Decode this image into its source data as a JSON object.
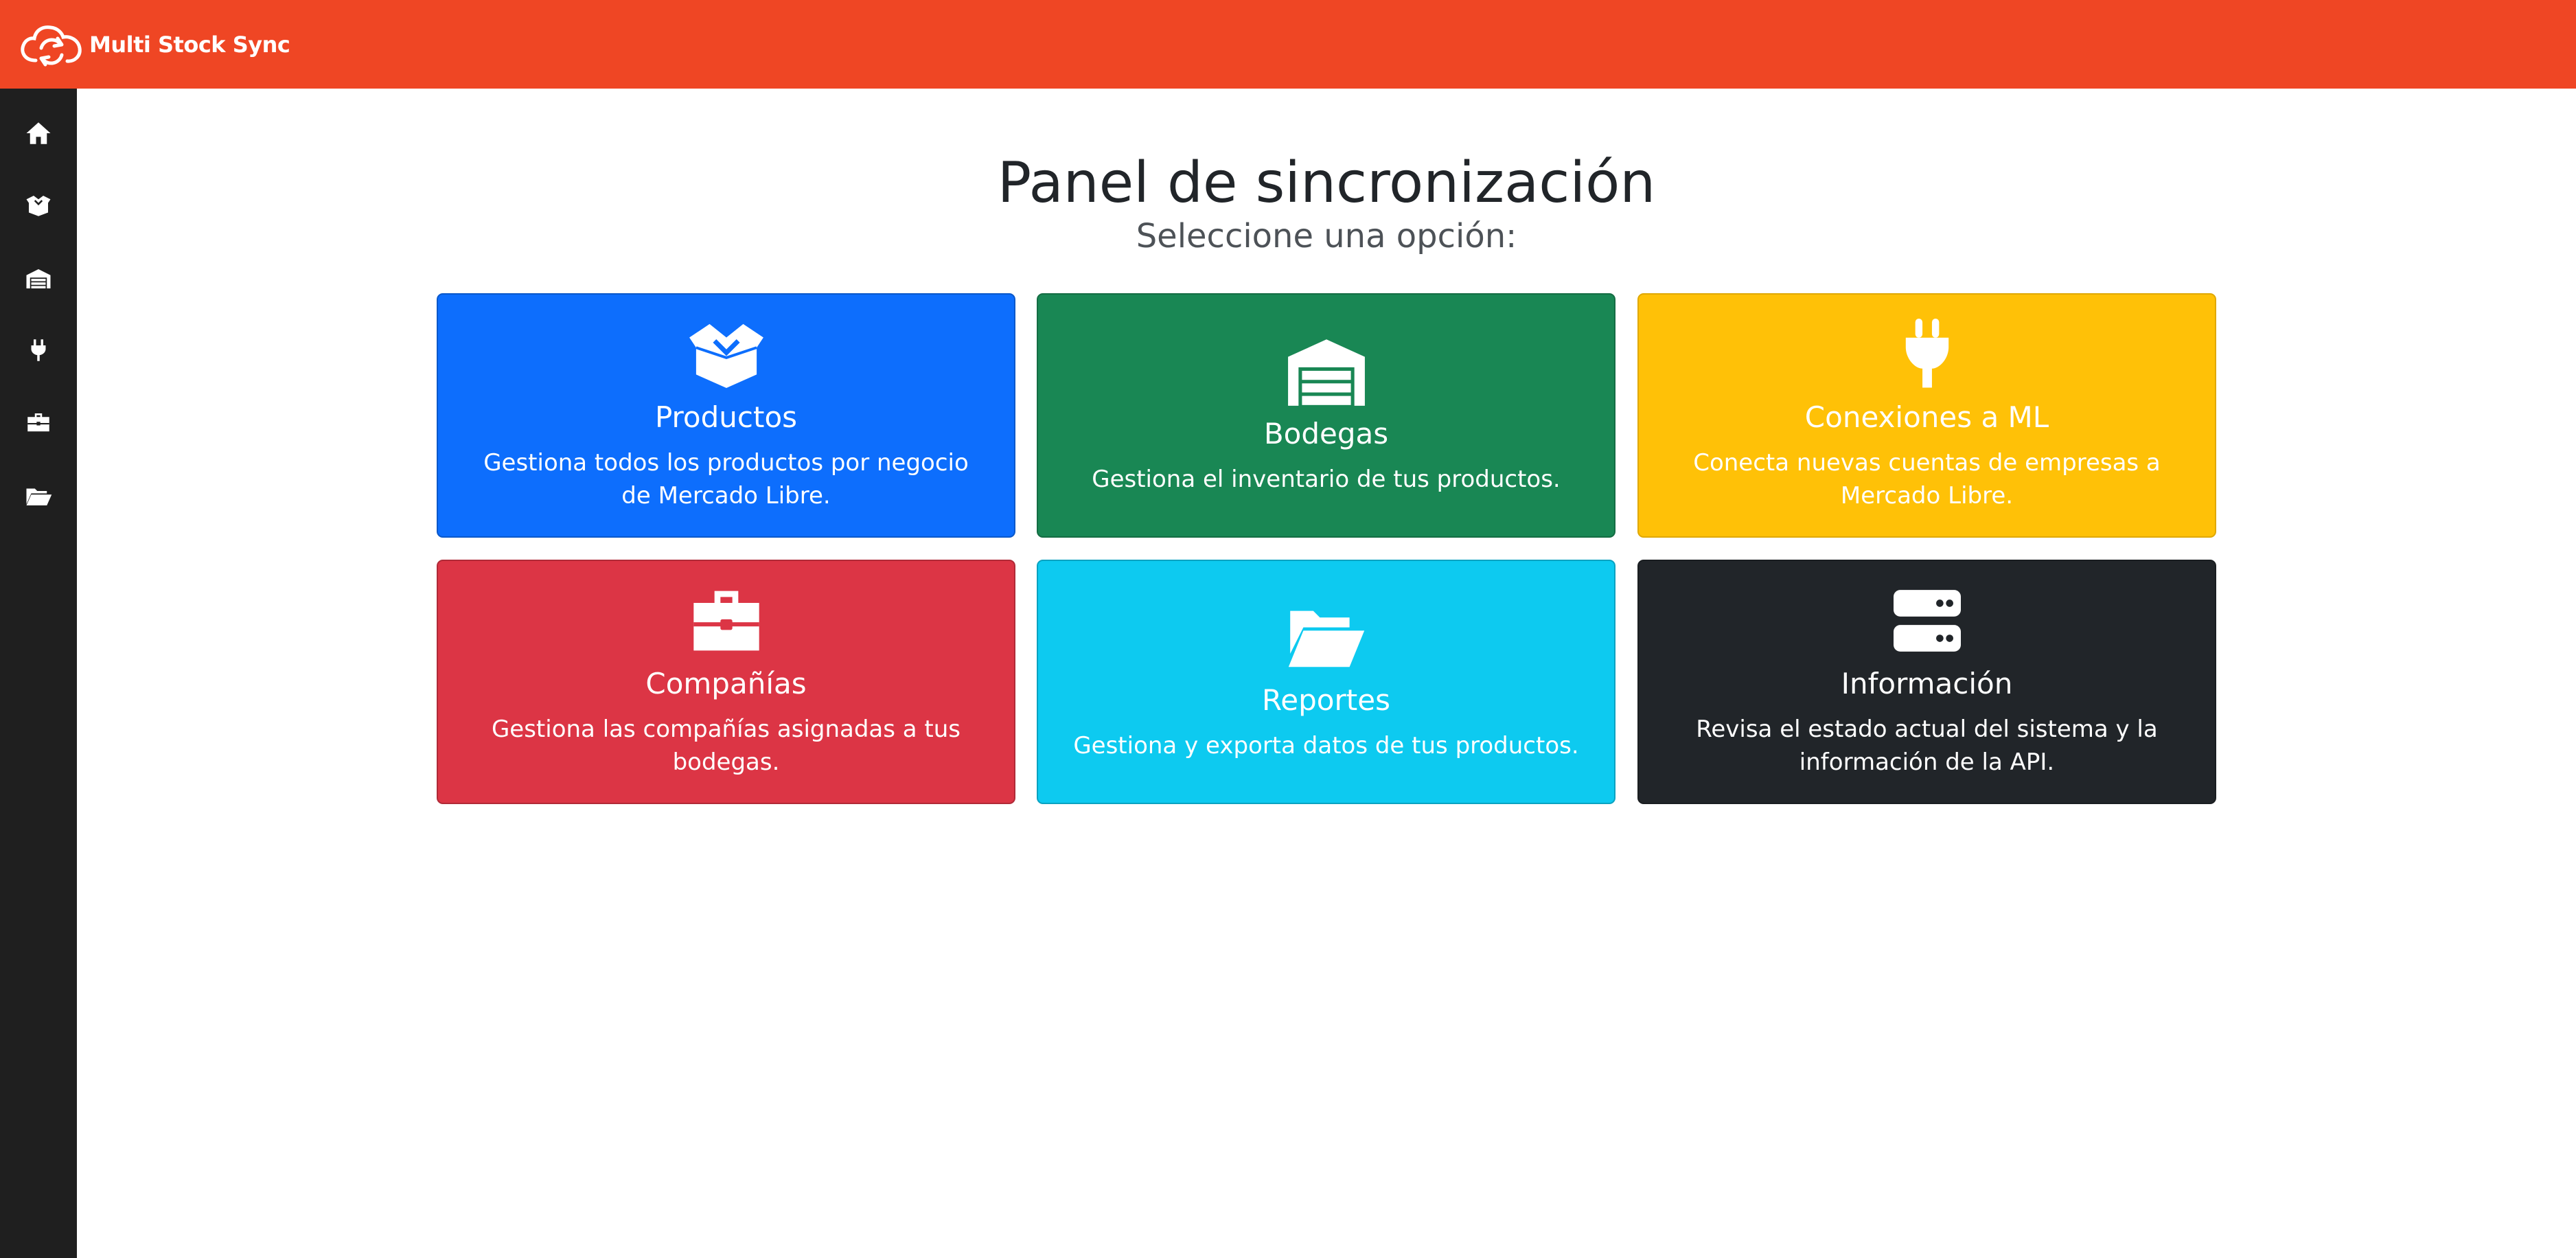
{
  "app": {
    "name": "Multi Stock Sync",
    "logo_icon": "sync-cloud-icon"
  },
  "colors": {
    "topbar": "#ef4624",
    "sidebar": "#1f1f1f",
    "productos": "#0d6efd",
    "bodegas": "#198754",
    "conexiones": "#ffc107",
    "companias": "#dc3545",
    "reportes": "#0dcaf0",
    "informacion": "#212529"
  },
  "sidebar": {
    "items": [
      {
        "icon": "home-icon"
      },
      {
        "icon": "box-open-icon"
      },
      {
        "icon": "warehouse-icon"
      },
      {
        "icon": "plug-icon"
      },
      {
        "icon": "briefcase-icon"
      },
      {
        "icon": "folder-open-icon"
      }
    ]
  },
  "main": {
    "title": "Panel de sincronización",
    "subtitle": "Seleccione una opción:"
  },
  "cards": [
    {
      "icon": "box-open-icon",
      "title": "Productos",
      "description": "Gestiona todos los productos por negocio de Mercado Libre."
    },
    {
      "icon": "warehouse-icon",
      "title": "Bodegas",
      "description": "Gestiona el inventario de tus productos."
    },
    {
      "icon": "plug-icon",
      "title": "Conexiones a ML",
      "description": "Conecta nuevas cuentas de empresas a Mercado Libre."
    },
    {
      "icon": "briefcase-icon",
      "title": "Compañías",
      "description": "Gestiona las compañías asignadas a tus bodegas."
    },
    {
      "icon": "folder-open-icon",
      "title": "Reportes",
      "description": "Gestiona y exporta datos de tus productos."
    },
    {
      "icon": "server-icon",
      "title": "Información",
      "description": "Revisa el estado actual del sistema y la información de la API."
    }
  ]
}
